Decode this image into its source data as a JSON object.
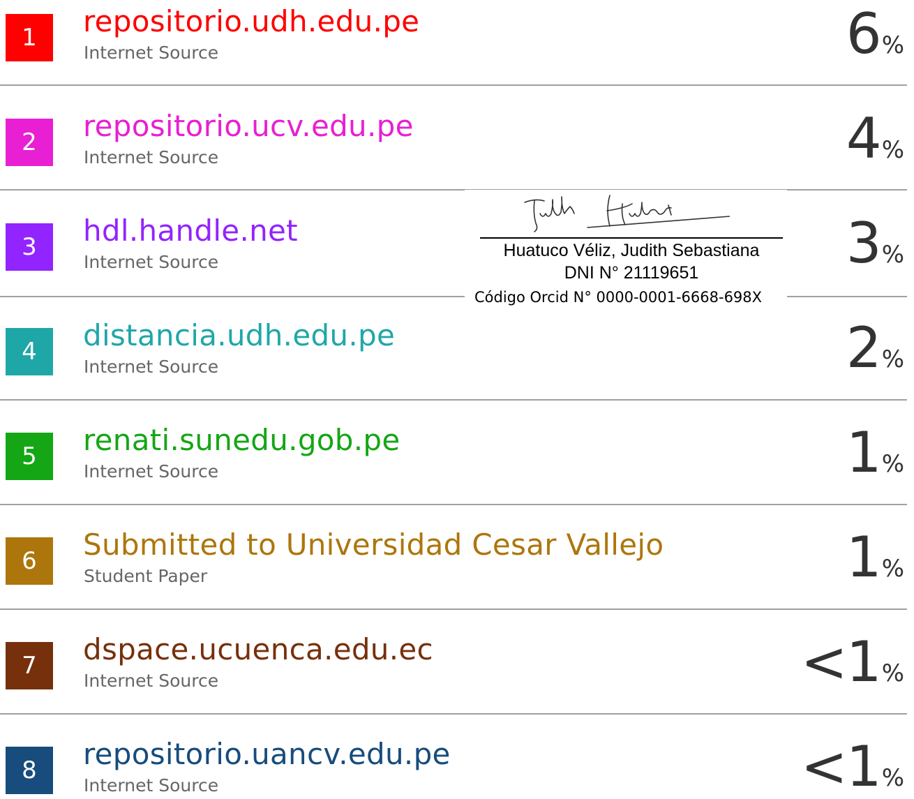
{
  "sources": [
    {
      "rank": "1",
      "name": "repositorio.udh.edu.pe",
      "type": "Internet Source",
      "percent": "6",
      "color": "#ff0000"
    },
    {
      "rank": "2",
      "name": "repositorio.ucv.edu.pe",
      "type": "Internet Source",
      "percent": "4",
      "color": "#e81fd2"
    },
    {
      "rank": "3",
      "name": "hdl.handle.net",
      "type": "Internet Source",
      "percent": "3",
      "color": "#9224ff"
    },
    {
      "rank": "4",
      "name": "distancia.udh.edu.pe",
      "type": "Internet Source",
      "percent": "2",
      "color": "#1fa7a8"
    },
    {
      "rank": "5",
      "name": "renati.sunedu.gob.pe",
      "type": "Internet Source",
      "percent": "1",
      "color": "#14a615"
    },
    {
      "rank": "6",
      "name": "Submitted to Universidad Cesar Vallejo",
      "type": "Student Paper",
      "percent": "1",
      "color": "#ad760c"
    },
    {
      "rank": "7",
      "name": "dspace.ucuenca.edu.ec",
      "type": "Internet Source",
      "percent": "<1",
      "color": "#76300c"
    },
    {
      "rank": "8",
      "name": "repositorio.uancv.edu.pe",
      "type": "Internet Source",
      "percent": "<1",
      "color": "#174c7c"
    }
  ],
  "percent_sign": "%",
  "signature": {
    "name": "Huatuco Véliz, Judith Sebastiana",
    "dni": "DNI N°  21119651",
    "orcid": "Código Orcid N° 0000-0001-6668-698X",
    "handwritten": "Judith Huatuco"
  }
}
